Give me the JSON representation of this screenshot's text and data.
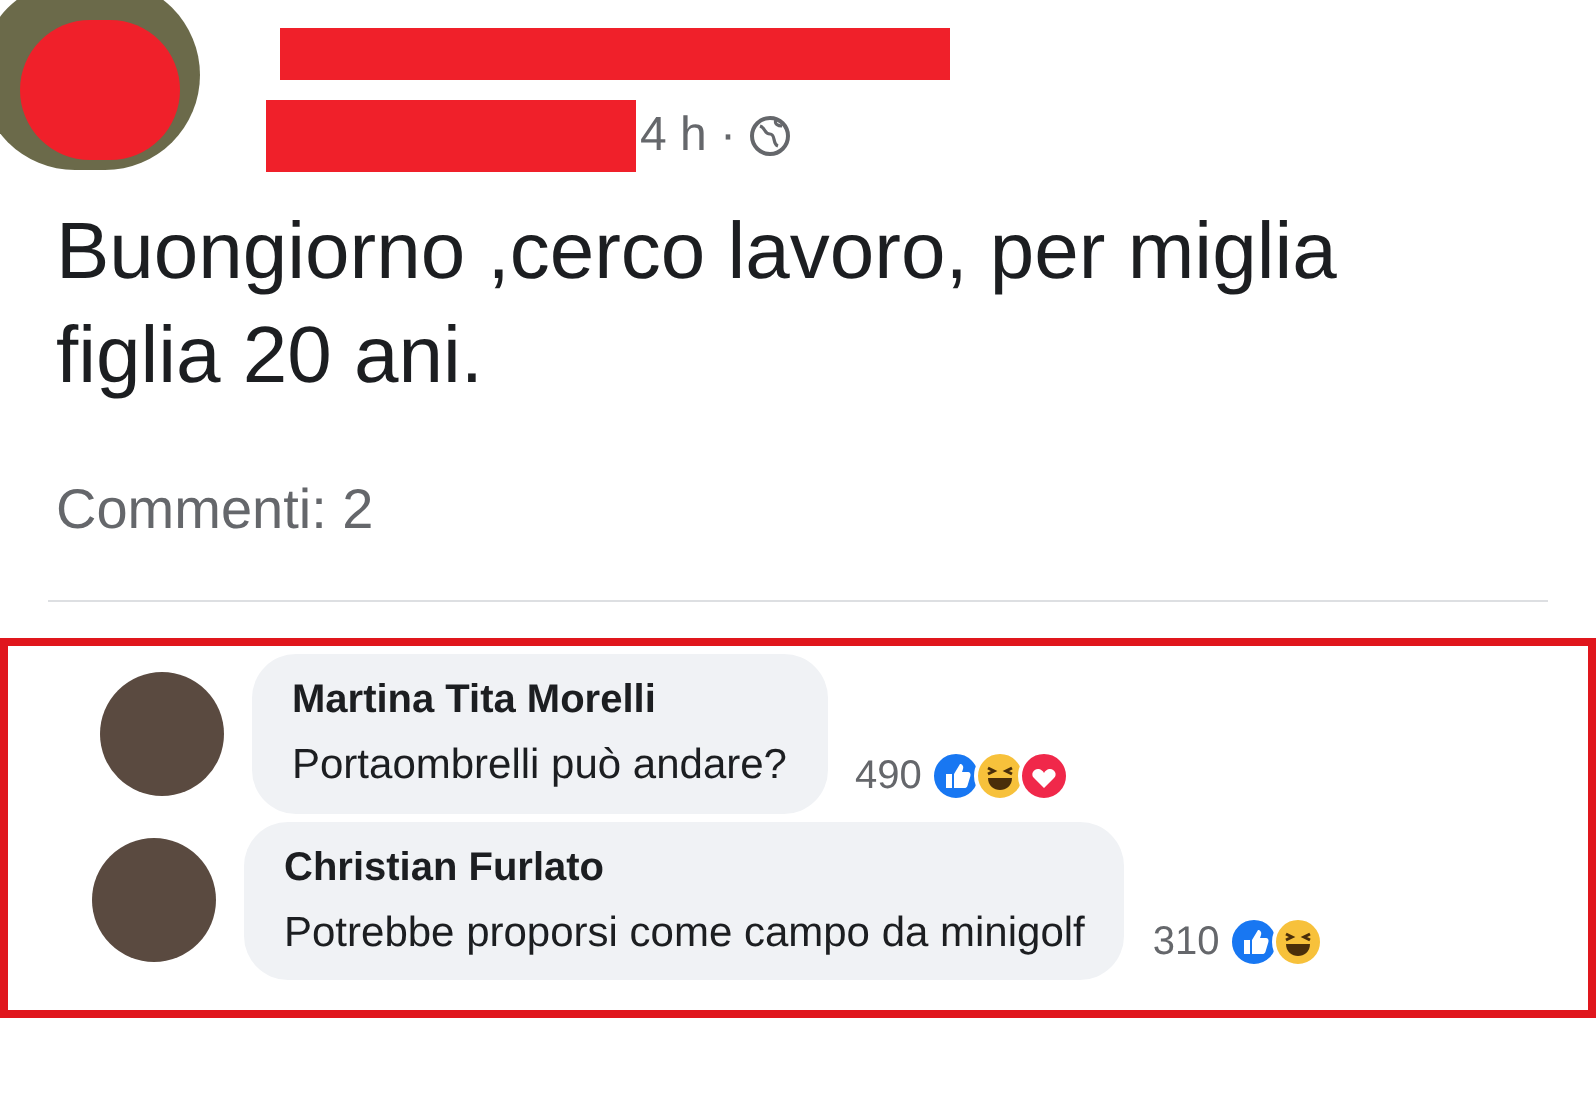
{
  "post": {
    "time": "4 h ·",
    "text": "Buongiorno ,cerco lavoro, per miglia figlia 20 ani.",
    "comment_count": "Commenti: 2"
  },
  "comments": [
    {
      "author": "Martina Tita Morelli",
      "text": "Portaombrelli può andare?",
      "reaction_count": "490",
      "reactions": [
        {
          "kind": "like"
        },
        {
          "kind": "haha"
        },
        {
          "kind": "love"
        }
      ]
    },
    {
      "author": "Christian Furlato",
      "text": "Potrebbe proporsi come campo da minigolf",
      "reaction_count": "310",
      "reactions": [
        {
          "kind": "like"
        },
        {
          "kind": "haha"
        }
      ]
    }
  ]
}
